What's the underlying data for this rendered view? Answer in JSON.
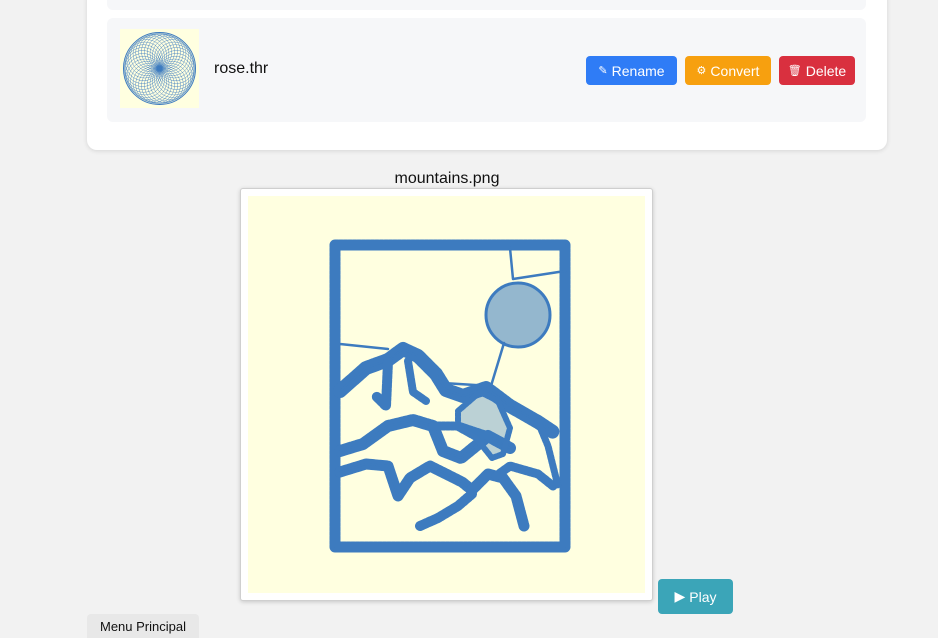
{
  "file_list": {
    "item": {
      "name": "rose.thr",
      "thumbnail_icon": "spiral-rose-pattern-icon",
      "buttons": {
        "rename": {
          "icon": "pencil-icon",
          "icon_glyph": "✎",
          "label": "Rename"
        },
        "convert": {
          "icon": "gear-icon",
          "icon_glyph": "⚙",
          "label": "Convert"
        },
        "delete": {
          "icon": "trash-icon",
          "icon_glyph": "🗑",
          "label": "Delete"
        }
      }
    }
  },
  "preview": {
    "title": "mountains.png",
    "image_icon": "mountains-pattern-icon",
    "play": {
      "icon": "play-icon",
      "icon_glyph": "▶",
      "label": "Play"
    }
  },
  "footer": {
    "menu_label": "Menu Principal"
  },
  "colors": {
    "page_bg": "#f2f2f2",
    "rename": "#2f7cf6",
    "convert": "#f7a00f",
    "delete": "#d9303f",
    "play": "#3ba5b8",
    "pattern_stroke": "#3d7bbf",
    "canvas_bg": "#ffffe0"
  }
}
